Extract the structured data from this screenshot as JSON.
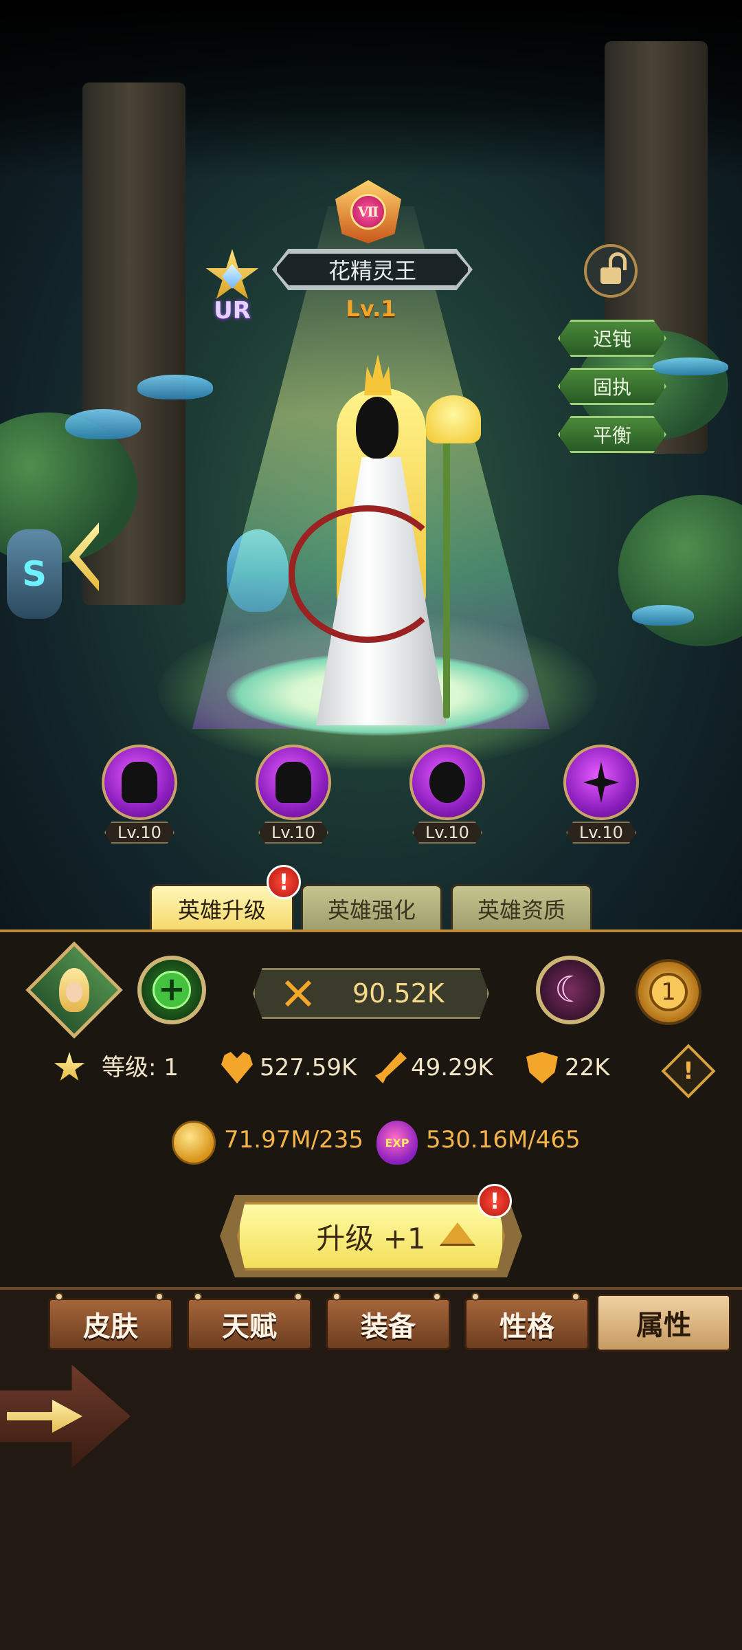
{
  "hero": {
    "rank_badge": "Ⅶ",
    "name": "花精灵王",
    "level": "Lv.1",
    "rarity": "UR",
    "traits": [
      "迟钝",
      "固执",
      "平衡"
    ]
  },
  "skills": [
    {
      "level": "Lv.10",
      "icon": "dash-skill-icon"
    },
    {
      "level": "Lv.10",
      "icon": "sword-slash-skill-icon"
    },
    {
      "level": "Lv.10",
      "icon": "skull-skill-icon"
    },
    {
      "level": "Lv.10",
      "icon": "crack-skill-icon"
    }
  ],
  "tabs": {
    "items": [
      "英雄升级",
      "英雄强化",
      "英雄资质"
    ],
    "active": "英雄升级",
    "alert_mark": "!"
  },
  "power": {
    "value": "90.52K"
  },
  "coin_button": {
    "value": "1"
  },
  "stats": {
    "level_label": "等级: 1",
    "hp": "527.59K",
    "attack": "49.29K",
    "defense": "22K"
  },
  "warning_mark": "!",
  "resources": {
    "gold": "71.97M/235",
    "exp_icon_text": "EXP",
    "exp": "530.16M/465"
  },
  "upgrade": {
    "label": "升级 +1",
    "alert_mark": "!"
  },
  "bottom_tabs": {
    "items": [
      "皮肤",
      "天赋",
      "装备",
      "性格",
      "属性"
    ],
    "active": "属性"
  },
  "rune_glyph": "S",
  "moon_glyph": "☾",
  "plus_glyph": "+",
  "colors": {
    "accent_gold": "#f4a62a",
    "trait_green": "#285a24",
    "skill_purple": "#8d1fbf",
    "alert_red": "#d7261c"
  }
}
